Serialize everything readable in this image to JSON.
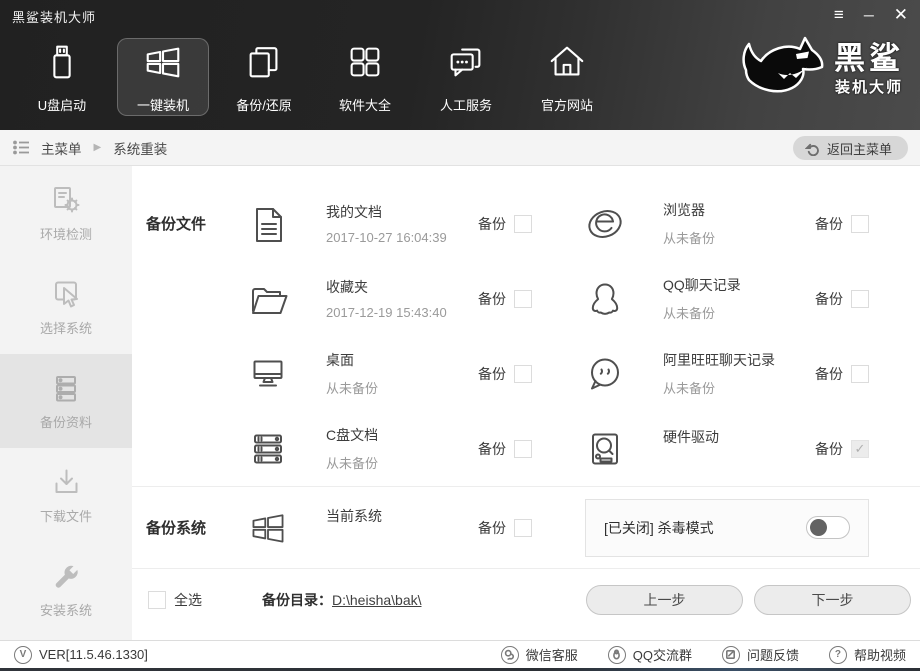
{
  "window": {
    "title": "黑鲨装机大师",
    "controls": {
      "menu": "≡",
      "minimize": "─",
      "close": "✕"
    }
  },
  "colors": {
    "header_dark": "#2b2b2b",
    "sidebar_bg": "#f3f3f3",
    "sidebar_active": "#e4e4e4",
    "panel_bg": "#fbfbfb"
  },
  "nav": {
    "items": [
      {
        "label": "U盘启动",
        "icon": "usb-drive-icon",
        "active": false
      },
      {
        "label": "一键装机",
        "icon": "windows-icon",
        "active": true
      },
      {
        "label": "备份/还原",
        "icon": "backup-restore-icon",
        "active": false
      },
      {
        "label": "软件大全",
        "icon": "apps-grid-icon",
        "active": false
      },
      {
        "label": "人工服务",
        "icon": "chat-bubbles-icon",
        "active": false
      },
      {
        "label": "官方网站",
        "icon": "home-icon",
        "active": false
      }
    ],
    "logo": {
      "line1": "黑鲨",
      "line2": "装机大师"
    }
  },
  "breadcrumb": {
    "home": "主菜单",
    "arrow": "▶",
    "current": "系统重装",
    "back": "返回主菜单"
  },
  "sidebar": {
    "items": [
      {
        "label": "环境检测",
        "active": false
      },
      {
        "label": "选择系统",
        "active": false
      },
      {
        "label": "备份资料",
        "active": true
      },
      {
        "label": "下载文件",
        "active": false
      },
      {
        "label": "安装系统",
        "active": false
      }
    ]
  },
  "main": {
    "section_files": "备份文件",
    "section_system": "备份系统",
    "backup_label": "备份",
    "items": [
      {
        "title": "我的文档",
        "subtitle": "2017-10-27 16:04:39",
        "checked": false
      },
      {
        "title": "浏览器",
        "subtitle": "从未备份",
        "checked": false
      },
      {
        "title": "收藏夹",
        "subtitle": "2017-12-19 15:43:40",
        "checked": false
      },
      {
        "title": "QQ聊天记录",
        "subtitle": "从未备份",
        "checked": false
      },
      {
        "title": "桌面",
        "subtitle": "从未备份",
        "checked": false
      },
      {
        "title": "阿里旺旺聊天记录",
        "subtitle": "从未备份",
        "checked": false
      },
      {
        "title": "C盘文档",
        "subtitle": "从未备份",
        "checked": false
      },
      {
        "title": "硬件驱动",
        "subtitle": "",
        "checked": true,
        "disabled": true
      },
      {
        "title": "当前系统",
        "subtitle": "",
        "checked": false
      }
    ],
    "antivirus": {
      "label": "[已关闭] 杀毒模式",
      "enabled": false
    },
    "footer": {
      "select_all": "全选",
      "dir_label": "备份目录：",
      "dir_value": "D:\\heisha\\bak\\",
      "prev": "上一步",
      "next": "下一步"
    }
  },
  "statusbar": {
    "version": "VER[11.5.46.1330]",
    "links": [
      {
        "label": "微信客服",
        "icon": "wechat-icon"
      },
      {
        "label": "QQ交流群",
        "icon": "qq-icon"
      },
      {
        "label": "问题反馈",
        "icon": "feedback-icon"
      },
      {
        "label": "帮助视频",
        "icon": "help-icon"
      }
    ]
  }
}
